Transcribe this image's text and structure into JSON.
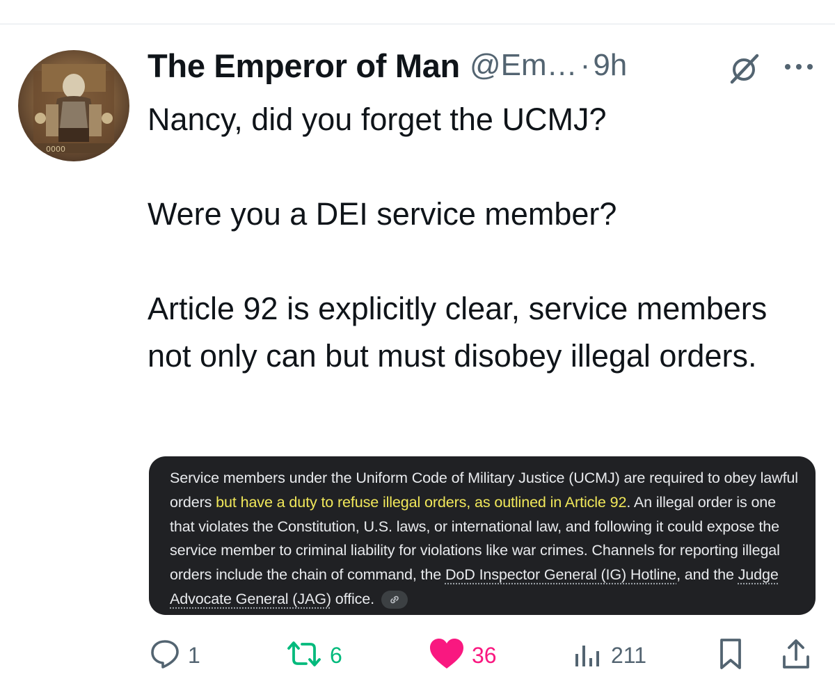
{
  "tweet": {
    "author": {
      "display_name": "The Emperor of Man",
      "handle": "@Em…",
      "separator": "·",
      "time": "9h"
    },
    "text": {
      "line1": "Nancy, did you forget the UCMJ?",
      "line2": "Were you a DEI service member?",
      "line3": "Article 92 is explicitly clear, service members not only can but must disobey illegal orders."
    },
    "embed": {
      "part1": "Service members under the Uniform Code of Military Justice (UCMJ) are required to obey lawful orders ",
      "highlight": "but have a duty to refuse illegal orders, as outlined in Article 92",
      "part2": ". An illegal order is one that violates the Constitution, U.S. laws, or international law, and following it could expose the service member to criminal liability for violations like war crimes. Channels for reporting illegal orders include the chain of command, the ",
      "link1": "DoD Inspector General (IG) Hotline",
      "part3": ", and the ",
      "link2": "Judge Advocate General (JAG)",
      "part4": " office."
    },
    "actions": {
      "replies": "1",
      "retweets": "6",
      "likes": "36",
      "views": "211"
    },
    "icons": {
      "grok": "grok-icon",
      "more": "more-icon",
      "reply": "reply-icon",
      "retweet": "retweet-icon",
      "like": "heart-icon",
      "views": "views-icon",
      "bookmark": "bookmark-icon",
      "share": "share-icon",
      "link": "link-icon"
    },
    "colors": {
      "text": "#0f1419",
      "muted": "#536471",
      "retweet_green": "#00ba7c",
      "like_pink": "#f91880",
      "embed_bg": "#202124",
      "highlight": "#f1e85a"
    }
  }
}
